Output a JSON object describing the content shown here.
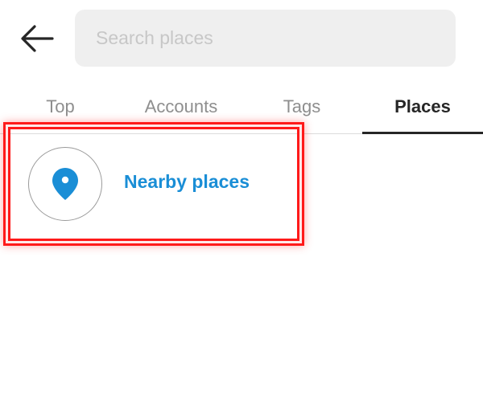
{
  "header": {
    "back_icon": "arrow-left-icon",
    "search": {
      "placeholder": "Search places",
      "value": ""
    }
  },
  "tabs": [
    {
      "label": "Top",
      "active": false
    },
    {
      "label": "Accounts",
      "active": false
    },
    {
      "label": "Tags",
      "active": false
    },
    {
      "label": "Places",
      "active": true
    }
  ],
  "nearby": {
    "icon": "location-pin-icon",
    "label": "Nearby places"
  },
  "colors": {
    "accent": "#1a8ed6",
    "search_bg": "#efefef",
    "highlight": "#ff1a1a",
    "inactive_tab": "#8e8e8e",
    "active_tab": "#262626"
  }
}
